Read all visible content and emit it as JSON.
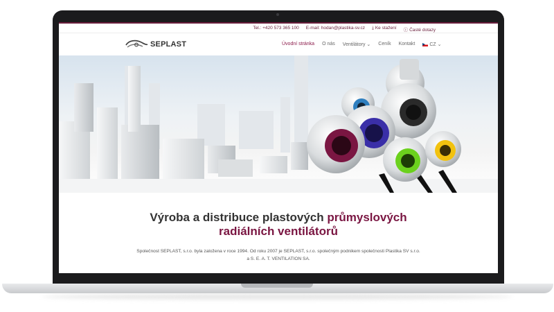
{
  "topbar": {
    "phone": "Tel.: +420 573 365 100",
    "email": "E-mail: hodan@plastika-sv.cz",
    "download": "Ke stažení",
    "faq": "Časté dotazy"
  },
  "logo": {
    "text": "SEPLAST"
  },
  "nav": {
    "items": [
      {
        "label": "Úvodní stránka",
        "active": true
      },
      {
        "label": "O nás"
      },
      {
        "label": "Ventilátory ⌄"
      },
      {
        "label": "Ceník"
      },
      {
        "label": "Kontakt"
      }
    ],
    "language": "CZ ⌄"
  },
  "hero": {
    "slider_dots": 2,
    "active_dot": 1
  },
  "headline": {
    "part1": "Výroba a distribuce plastových ",
    "accent1": "průmyslových",
    "accent2": "radiálních ventilátorů"
  },
  "intro": {
    "line1": "Společnost SEPLAST, s.r.o. byla založena v roce 1994. Od roku 2007 je SEPLAST, s.r.o. společným podnikem společnosti Plastika SV s.r.o.",
    "line2": "a S. E. A. T. VENTILATION SA."
  },
  "colors": {
    "brand": "#7a1642",
    "topbar_border": "#6a1e3c",
    "text": "#333333"
  }
}
